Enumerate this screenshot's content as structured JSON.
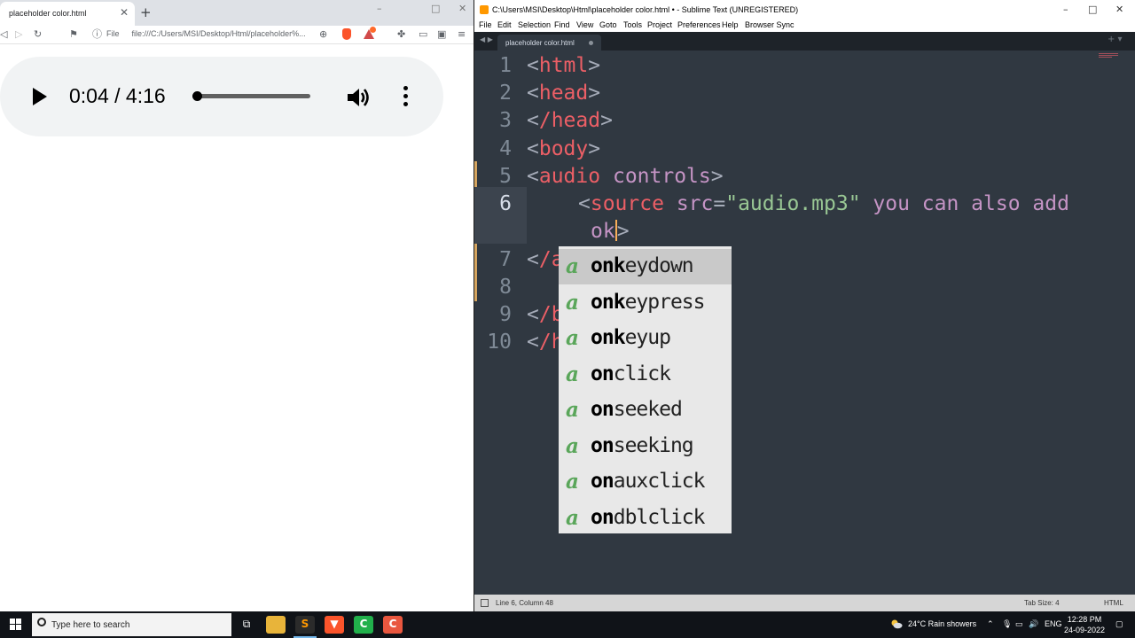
{
  "browser": {
    "tab_title": "placeholder color.html",
    "tab_close": "✕",
    "new_tab": "+",
    "url_scheme_label": "File",
    "url": "file:///C:/Users/MSI/Desktop/Html/placeholder%...",
    "audio": {
      "time_display": "0:04 / 4:16",
      "progress": 0.016
    }
  },
  "sublime": {
    "title": "C:\\Users\\MSI\\Desktop\\Html\\placeholder color.html • - Sublime Text (UNREGISTERED)",
    "menu": [
      "File",
      "Edit",
      "Selection",
      "Find",
      "View",
      "Goto",
      "Tools",
      "Project",
      "Preferences",
      "Help",
      "Browser Sync"
    ],
    "tab_title": "placeholder color.html",
    "line_numbers": [
      "1",
      "2",
      "3",
      "4",
      "5",
      "6",
      "7",
      "8",
      "9",
      "10"
    ],
    "code": {
      "l1_tag": "html",
      "l2_tag": "head",
      "l3_tag": "/head",
      "l4_tag": "body",
      "l5_tag": "audio",
      "l5_attr": "controls",
      "l6_tag": "source",
      "l6_attr": "src",
      "l6_str": "\"audio.mp3\"",
      "l6_text": "you can also add",
      "l6b_text": "ok",
      "l7_tag": "/a",
      "l9_tag": "/b",
      "l10_tag": "/h"
    },
    "autocomplete": {
      "kind_glyph": "a",
      "items": [
        {
          "pre": "o",
          "k": "nk",
          "rest": "eydown"
        },
        {
          "pre": "o",
          "k": "nk",
          "rest": "eypress"
        },
        {
          "pre": "o",
          "k": "nk",
          "rest": "eyup"
        },
        {
          "pre": "o",
          "k": "n",
          "rest": "click"
        },
        {
          "pre": "o",
          "k": "n",
          "rest": "seeked"
        },
        {
          "pre": "o",
          "k": "n",
          "rest": "seeking"
        },
        {
          "pre": "o",
          "k": "n",
          "rest": "auxclick"
        },
        {
          "pre": "o",
          "k": "n",
          "rest": "dblclick"
        }
      ]
    },
    "status": {
      "position": "Line 6, Column 48",
      "tab_size": "Tab Size: 4",
      "syntax": "HTML"
    }
  },
  "taskbar": {
    "search_placeholder": "Type here to search",
    "weather": "24°C  Rain showers",
    "language": "ENG",
    "time": "12:28 PM",
    "date": "24-09-2022"
  }
}
